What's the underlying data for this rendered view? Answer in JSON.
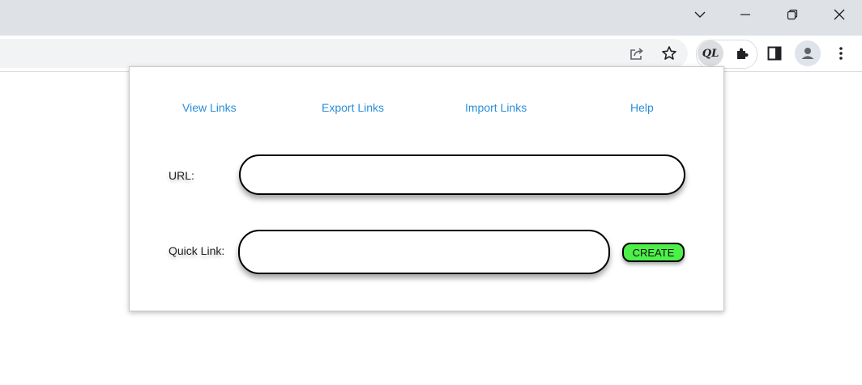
{
  "browser": {
    "window_controls": {
      "tab_search_icon": "chevron-down-icon",
      "minimize_icon": "minimize-icon",
      "restore_icon": "restore-icon",
      "close_icon": "close-icon"
    },
    "toolbar": {
      "share_icon": "share-icon",
      "bookmark_icon": "star-icon",
      "extension_badge": "QL",
      "extensions_icon": "puzzle-icon",
      "side_panel_icon": "side-panel-icon",
      "profile_icon": "profile-icon",
      "menu_icon": "more-vert-icon"
    }
  },
  "popup": {
    "nav": {
      "view_links": "View Links",
      "export_links": "Export Links",
      "import_links": "Import Links",
      "help": "Help"
    },
    "form": {
      "url_label": "URL:",
      "url_value": "",
      "quick_link_label": "Quick Link:",
      "quick_link_value": "",
      "create_label": "CREATE"
    }
  },
  "colors": {
    "link": "#2a8ed8",
    "create_button": "#4cf049",
    "titlebar": "#dee1e6"
  }
}
